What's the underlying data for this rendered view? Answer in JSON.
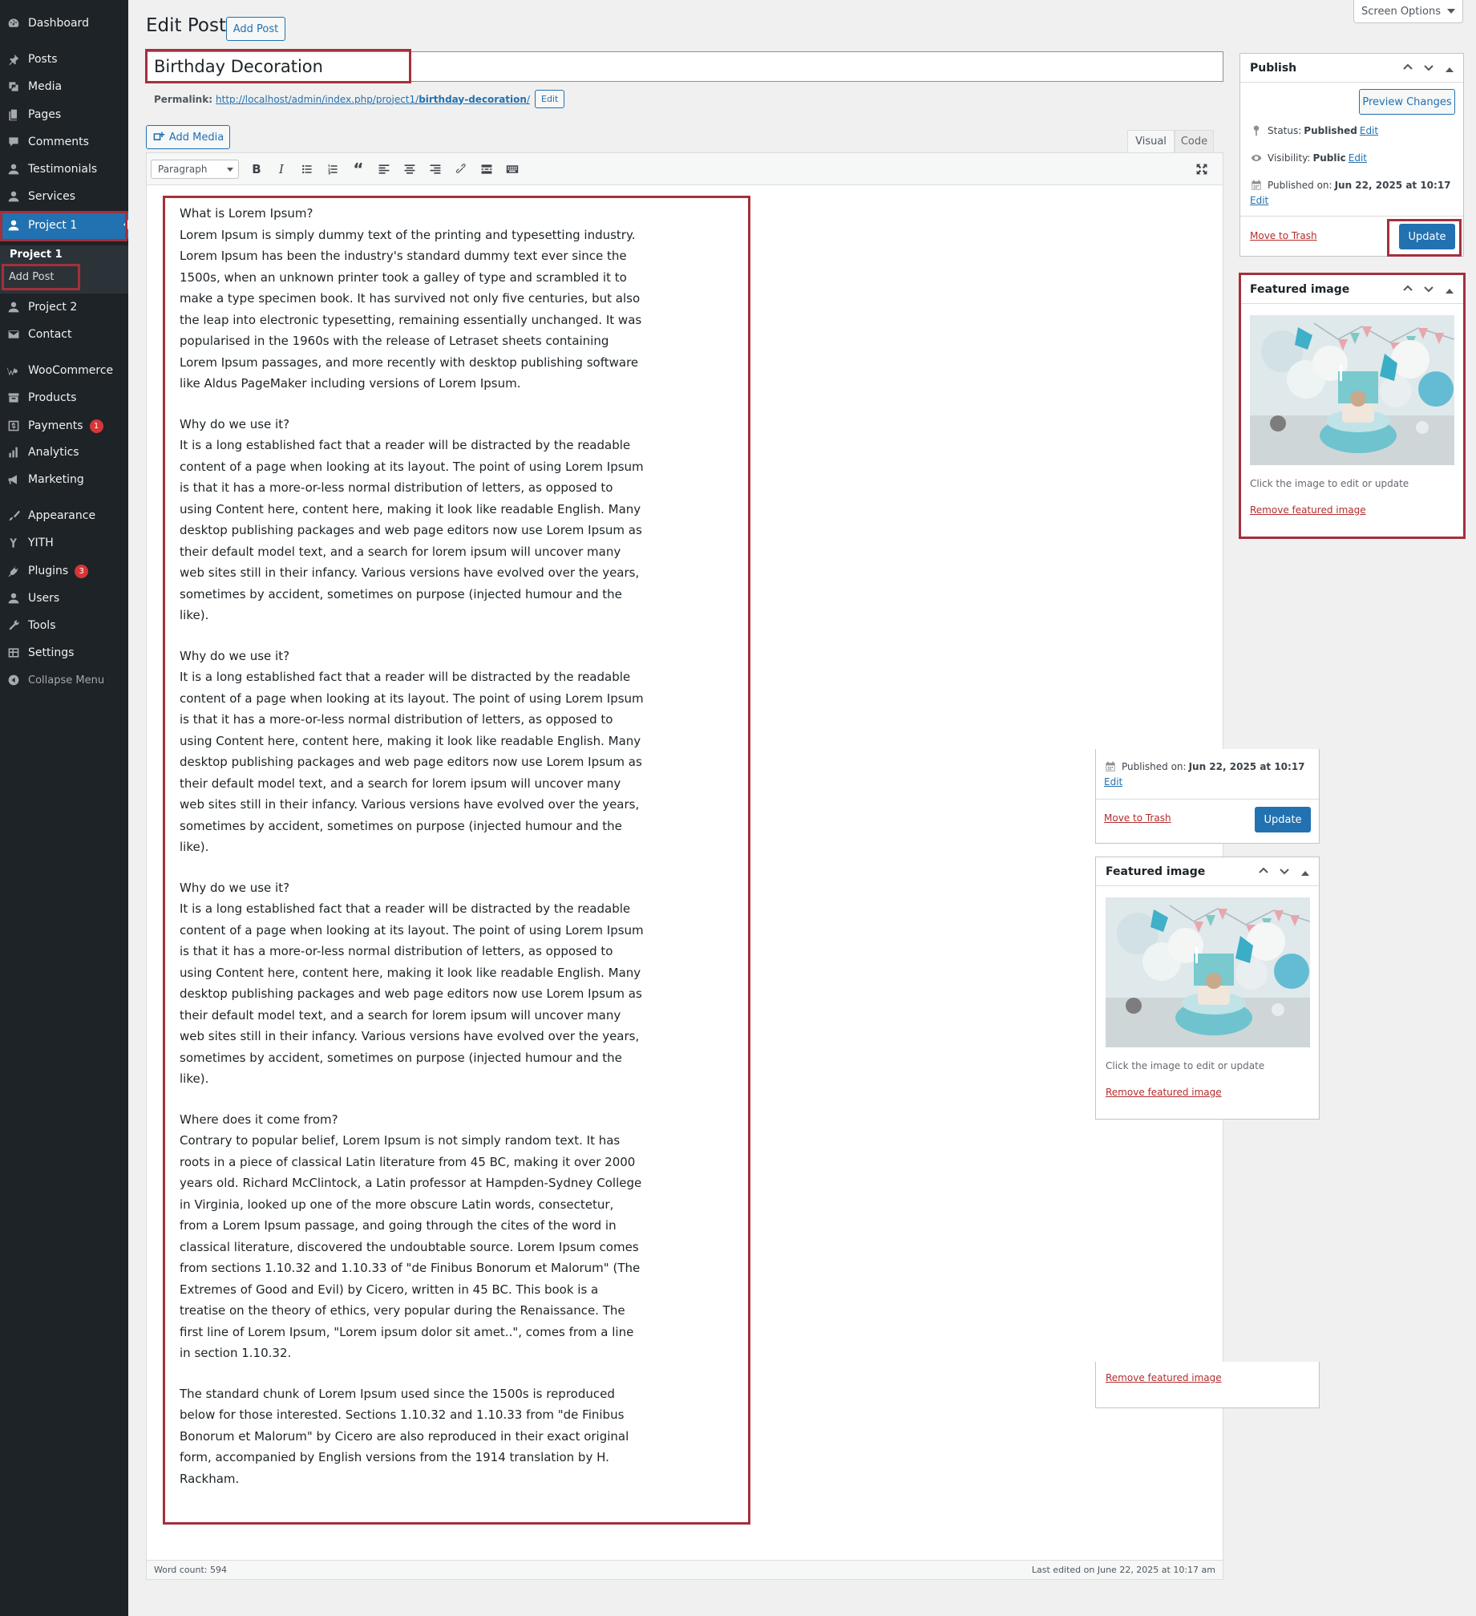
{
  "sidebar": {
    "items": [
      {
        "label": "Dashboard",
        "icon": "dashboard-icon"
      },
      {
        "label": "Posts",
        "icon": "pushpin-icon"
      },
      {
        "label": "Media",
        "icon": "media-icon"
      },
      {
        "label": "Pages",
        "icon": "pages-icon"
      },
      {
        "label": "Comments",
        "icon": "comment-icon"
      },
      {
        "label": "Testimonials",
        "icon": "user-icon"
      },
      {
        "label": "Services",
        "icon": "user-icon"
      },
      {
        "label": "Project 1",
        "icon": "user-icon"
      },
      {
        "label": "Project 2",
        "icon": "user-icon"
      },
      {
        "label": "Contact",
        "icon": "envelope-icon"
      },
      {
        "label": "WooCommerce",
        "icon": "woo-icon"
      },
      {
        "label": "Products",
        "icon": "archive-icon"
      },
      {
        "label": "Payments",
        "icon": "dollar-icon",
        "badge": "1"
      },
      {
        "label": "Analytics",
        "icon": "bar-chart-icon"
      },
      {
        "label": "Marketing",
        "icon": "megaphone-icon"
      },
      {
        "label": "Appearance",
        "icon": "brush-icon"
      },
      {
        "label": "YITH",
        "icon": "yith-icon"
      },
      {
        "label": "Plugins",
        "icon": "plug-icon",
        "badge": "3"
      },
      {
        "label": "Users",
        "icon": "user-icon"
      },
      {
        "label": "Tools",
        "icon": "wrench-icon"
      },
      {
        "label": "Settings",
        "icon": "settings-icon"
      },
      {
        "label": "Collapse Menu",
        "icon": "collapse-icon"
      }
    ],
    "submenu": {
      "heading": "Project 1",
      "item": "Add Post"
    }
  },
  "header": {
    "title": "Edit Post",
    "add_post_label": "Add Post",
    "screen_options_label": "Screen Options"
  },
  "post": {
    "title": "Birthday Decoration",
    "permalink_label": "Permalink:",
    "permalink_base": "http://localhost/admin/index.php/project1/",
    "permalink_slug": "birthday-decoration",
    "permalink_trailing": "/",
    "permalink_edit_label": "Edit"
  },
  "editor": {
    "add_media_label": "Add Media",
    "tab_visual": "Visual",
    "tab_code": "Code",
    "format_select_value": "Paragraph",
    "paragraphs": [
      "What is Lorem Ipsum?\nLorem Ipsum is simply dummy text of the printing and typesetting industry. Lorem Ipsum has been the industry's standard dummy text ever since the 1500s, when an unknown printer took a galley of type and scrambled it to make a type specimen book. It has survived not only five centuries, but also the leap into electronic typesetting, remaining essentially unchanged. It was popularised in the 1960s with the release of Letraset sheets containing Lorem Ipsum passages, and more recently with desktop publishing software like Aldus PageMaker including versions of Lorem Ipsum.",
      "Why do we use it?\nIt is a long established fact that a reader will be distracted by the readable content of a page when looking at its layout. The point of using Lorem Ipsum is that it has a more-or-less normal distribution of letters, as opposed to using Content here, content here, making it look like readable English. Many desktop publishing packages and web page editors now use Lorem Ipsum as their default model text, and a search for lorem ipsum will uncover many web sites still in their infancy. Various versions have evolved over the years, sometimes by accident, sometimes on purpose (injected humour and the like).",
      "Why do we use it?\nIt is a long established fact that a reader will be distracted by the readable content of a page when looking at its layout. The point of using Lorem Ipsum is that it has a more-or-less normal distribution of letters, as opposed to using Content here, content here, making it look like readable English. Many desktop publishing packages and web page editors now use Lorem Ipsum as their default model text, and a search for lorem ipsum will uncover many web sites still in their infancy. Various versions have evolved over the years, sometimes by accident, sometimes on purpose (injected humour and the like).",
      "Why do we use it?\nIt is a long established fact that a reader will be distracted by the readable content of a page when looking at its layout. The point of using Lorem Ipsum is that it has a more-or-less normal distribution of letters, as opposed to using Content here, content here, making it look like readable English. Many desktop publishing packages and web page editors now use Lorem Ipsum as their default model text, and a search for lorem ipsum will uncover many web sites still in their infancy. Various versions have evolved over the years, sometimes by accident, sometimes on purpose (injected humour and the like).",
      "Where does it come from?\nContrary to popular belief, Lorem Ipsum is not simply random text. It has roots in a piece of classical Latin literature from 45 BC, making it over 2000 years old. Richard McClintock, a Latin professor at Hampden-Sydney College in Virginia, looked up one of the more obscure Latin words, consectetur, from a Lorem Ipsum passage, and going through the cites of the word in classical literature, discovered the undoubtable source. Lorem Ipsum comes from sections 1.10.32 and 1.10.33 of \"de Finibus Bonorum et Malorum\" (The Extremes of Good and Evil) by Cicero, written in 45 BC. This book is a treatise on the theory of ethics, very popular during the Renaissance. The first line of Lorem Ipsum, \"Lorem ipsum dolor sit amet..\", comes from a line in section 1.10.32.",
      "The standard chunk of Lorem Ipsum used since the 1500s is reproduced below for those interested. Sections 1.10.32 and 1.10.33 from \"de Finibus Bonorum et Malorum\" by Cicero are also reproduced in their exact original form, accompanied by English versions from the 1914 translation by H. Rackham."
    ],
    "word_count": "Word count: 594",
    "last_edited": "Last edited on June 22, 2025 at 10:17 am"
  },
  "publish": {
    "title": "Publish",
    "preview_label": "Preview Changes",
    "status_label": "Status:",
    "status_value": "Published",
    "visibility_label": "Visibility:",
    "visibility_value": "Public",
    "published_label": "Published on:",
    "published_value": "Jun 22, 2025 at 10:17",
    "edit_label": "Edit",
    "trash_label": "Move to Trash",
    "update_label": "Update"
  },
  "featured": {
    "title": "Featured image",
    "hint": "Click the image to edit or update",
    "remove_label": "Remove featured image"
  },
  "colors": {
    "sidebar_bg": "#1d2327",
    "accent": "#2271b1",
    "highlight": "#a4303b",
    "trash": "#b32d2e"
  }
}
